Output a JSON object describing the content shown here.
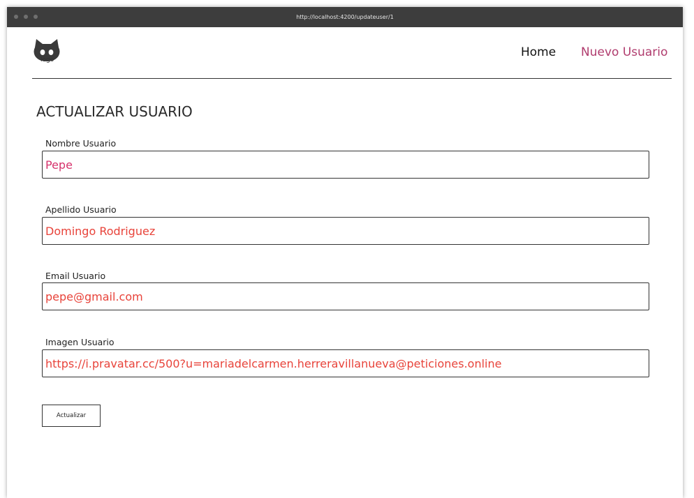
{
  "browser": {
    "url": "http://localhost:4200/updateuser/1"
  },
  "header": {
    "logo_text": "logo",
    "nav": {
      "home": "Home",
      "new_user": "Nuevo Usuario"
    }
  },
  "form": {
    "title": "ACTUALIZAR USUARIO",
    "fields": [
      {
        "label": "Nombre Usuario",
        "value": "Pepe"
      },
      {
        "label": "Apellido Usuario",
        "value": "Domingo Rodriguez"
      },
      {
        "label": "Email Usuario",
        "value": "pepe@gmail.com"
      },
      {
        "label": "Imagen Usuario",
        "value": "https://i.pravatar.cc/500?u=mariadelcarmen.herreravillanueva@peticiones.online"
      }
    ],
    "submit_label": "Actualizar"
  },
  "colors": {
    "titlebar": "#3d3d3d",
    "nav_accent": "#b03c6e",
    "input_text_pink": "#d6336c",
    "input_text_red": "#e8433a"
  }
}
